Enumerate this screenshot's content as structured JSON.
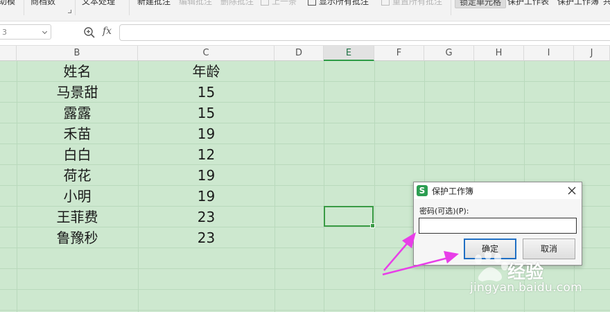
{
  "ribbon": {
    "items": [
      "助模",
      "商档数",
      "文本处理",
      "新建批注",
      "编辑批注",
      "删除批注",
      "上一条",
      "显示所有批注",
      "重置所有批注",
      "锁定单元格",
      "保护工作表",
      "保护工作簿",
      "共"
    ]
  },
  "formula_bar": {
    "name_box": "3",
    "fx_label": "fx",
    "formula_value": ""
  },
  "columns": [
    "B",
    "C",
    "D",
    "E",
    "F",
    "G",
    "H",
    "I",
    "J"
  ],
  "sheet": {
    "header_row": [
      "姓名",
      "年龄"
    ],
    "rows": [
      [
        "马景甜",
        "15"
      ],
      [
        "露露",
        "15"
      ],
      [
        "禾苗",
        "19"
      ],
      [
        "白白",
        "12"
      ],
      [
        "荷花",
        "19"
      ],
      [
        "小明",
        "19"
      ],
      [
        "王菲费",
        "23"
      ],
      [
        "鲁豫秒",
        "23"
      ]
    ]
  },
  "dialog": {
    "icon_letter": "S",
    "title": "保护工作簿",
    "password_label": "密码(可选)(P):",
    "password_value": "",
    "ok_label": "确定",
    "cancel_label": "取消"
  },
  "watermark": {
    "brand": "经验",
    "url": "jingyan.baidu.com"
  },
  "colors": {
    "sheet_bg": "#cde8cf",
    "selection": "#3a9b45",
    "arrow": "#e83ee8",
    "ok_border": "#1f6fc4"
  },
  "icons": [
    "zoom-icon",
    "close-icon",
    "wps-sheet-icon",
    "baidu-paw-icon",
    "annotation-arrow"
  ]
}
